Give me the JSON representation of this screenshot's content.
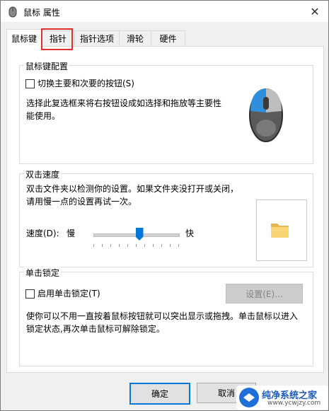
{
  "window": {
    "title": "鼠标 属性"
  },
  "tabs": [
    "鼠标键",
    "指针",
    "指针选项",
    "滑轮",
    "硬件"
  ],
  "button_config": {
    "group_label": "鼠标键配置",
    "switch_label": "切换主要和次要的按钮(S)",
    "description": "选择此复选框来将右按钮设成如选择和拖放等主要性能使用。"
  },
  "double_click": {
    "group_label": "双击速度",
    "description": "双击文件夹以检测你的设置。如果文件夹没打开或关闭，请用慢一点的设置再试一次。",
    "speed_label": "速度(D):",
    "slow_label": "慢",
    "fast_label": "快",
    "speed_fraction": 0.5
  },
  "click_lock": {
    "group_label": "单击锁定",
    "enable_label": "启用单击锁定(T)",
    "settings_label": "设置(E)...",
    "description": "使你可以不用一直按着鼠标按钮就可以突出显示或拖拽。单击鼠标以进入锁定状态,再次单击鼠标可解除锁定。"
  },
  "footer": {
    "ok_label": "确定",
    "cancel_label": "取消"
  },
  "watermark": {
    "text": "纯净系统之家",
    "url": "www.ycwjzy.com"
  }
}
